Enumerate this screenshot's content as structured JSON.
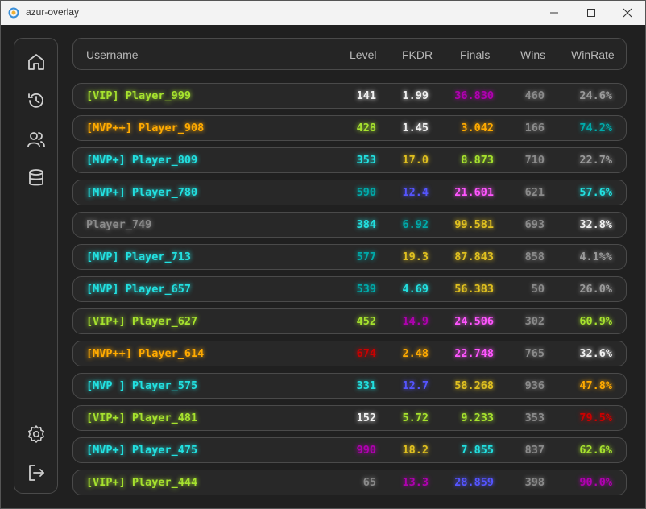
{
  "window": {
    "title": "azur-overlay"
  },
  "sidebar": {
    "items": [
      {
        "name": "home-icon"
      },
      {
        "name": "history-icon"
      },
      {
        "name": "users-icon"
      },
      {
        "name": "database-icon"
      }
    ],
    "bottom": [
      {
        "name": "settings-icon"
      },
      {
        "name": "logout-icon"
      }
    ]
  },
  "table": {
    "headers": {
      "username": "Username",
      "level": "Level",
      "fkdr": "FKDR",
      "finals": "Finals",
      "wins": "Wins",
      "winrate": "WinRate"
    },
    "rows": [
      {
        "rank": "[VIP] ",
        "name": "Player_999",
        "level": "141",
        "fkdr": "1.99",
        "finals": "36.830",
        "wins": "460",
        "winrate": "24.6%",
        "c": {
          "rank": "#a6e22e",
          "name": "#a6e22e",
          "level": "#f0f0f0",
          "fkdr": "#f0f0f0",
          "finals": "#b000b0",
          "wins": "#8a8a8a",
          "winrate": "#9a9a9a"
        }
      },
      {
        "rank": "[MVP++] ",
        "name": "Player_908",
        "level": "428",
        "fkdr": "1.45",
        "finals": "3.042",
        "wins": "166",
        "winrate": "74.2%",
        "c": {
          "rank": "#ffaa00",
          "name": "#ffaa00",
          "level": "#a6e22e",
          "fkdr": "#f0f0f0",
          "finals": "#ffaa00",
          "wins": "#8a8a8a",
          "winrate": "#00aaaa"
        }
      },
      {
        "rank": "[MVP+] ",
        "name": "Player_809",
        "level": "353",
        "fkdr": "17.0",
        "finals": "8.873",
        "wins": "710",
        "winrate": "22.7%",
        "c": {
          "rank": "#22e0e0",
          "name": "#22e0e0",
          "level": "#22e0e0",
          "fkdr": "#e0c020",
          "finals": "#a6e22e",
          "wins": "#8a8a8a",
          "winrate": "#9a9a9a"
        }
      },
      {
        "rank": "[MVP+] ",
        "name": "Player_780",
        "level": "590",
        "fkdr": "12.4",
        "finals": "21.601",
        "wins": "621",
        "winrate": "57.6%",
        "c": {
          "rank": "#22e0e0",
          "name": "#22e0e0",
          "level": "#00aaaa",
          "fkdr": "#5555ff",
          "finals": "#ff55ff",
          "wins": "#8a8a8a",
          "winrate": "#22e0e0"
        }
      },
      {
        "rank": "",
        "name": "Player_749",
        "level": "384",
        "fkdr": "6.92",
        "finals": "99.581",
        "wins": "693",
        "winrate": "32.8%",
        "c": {
          "rank": "#8a8a8a",
          "name": "#8a8a8a",
          "level": "#22e0e0",
          "fkdr": "#00aaaa",
          "finals": "#e0c020",
          "wins": "#8a8a8a",
          "winrate": "#f0f0f0"
        }
      },
      {
        "rank": "[MVP] ",
        "name": "Player_713",
        "level": "577",
        "fkdr": "19.3",
        "finals": "87.843",
        "wins": "858",
        "winrate": "4.1%%",
        "c": {
          "rank": "#22e0e0",
          "name": "#22e0e0",
          "level": "#00aaaa",
          "fkdr": "#e0c020",
          "finals": "#e0c020",
          "wins": "#8a8a8a",
          "winrate": "#9a9a9a"
        }
      },
      {
        "rank": "[MVP] ",
        "name": "Player_657",
        "level": "539",
        "fkdr": "4.69",
        "finals": "56.383",
        "wins": "50",
        "winrate": "26.0%",
        "c": {
          "rank": "#22e0e0",
          "name": "#22e0e0",
          "level": "#00aaaa",
          "fkdr": "#22e0e0",
          "finals": "#e0c020",
          "wins": "#8a8a8a",
          "winrate": "#9a9a9a"
        }
      },
      {
        "rank": "[VIP+] ",
        "name": "Player_627",
        "level": "452",
        "fkdr": "14.9",
        "finals": "24.506",
        "wins": "302",
        "winrate": "60.9%",
        "c": {
          "rank": "#a6e22e",
          "name": "#a6e22e",
          "level": "#a6e22e",
          "fkdr": "#b000b0",
          "finals": "#ff55ff",
          "wins": "#8a8a8a",
          "winrate": "#a6e22e"
        }
      },
      {
        "rank": "[MVP++] ",
        "name": "Player_614",
        "level": "674",
        "fkdr": "2.48",
        "finals": "22.748",
        "wins": "765",
        "winrate": "32.6%",
        "c": {
          "rank": "#ffaa00",
          "name": "#ffaa00",
          "level": "#cc0000",
          "fkdr": "#ffaa00",
          "finals": "#ff55ff",
          "wins": "#8a8a8a",
          "winrate": "#f0f0f0"
        }
      },
      {
        "rank": "[MVP ] ",
        "name": "Player_575",
        "level": "331",
        "fkdr": "12.7",
        "finals": "58.268",
        "wins": "936",
        "winrate": "47.8%",
        "c": {
          "rank": "#22e0e0",
          "name": "#22e0e0",
          "level": "#22e0e0",
          "fkdr": "#5555ff",
          "finals": "#e0c020",
          "wins": "#8a8a8a",
          "winrate": "#ffaa00"
        }
      },
      {
        "rank": "[VIP+] ",
        "name": "Player_481",
        "level": "152",
        "fkdr": "5.72",
        "finals": "9.233",
        "wins": "353",
        "winrate": "79.5%",
        "c": {
          "rank": "#a6e22e",
          "name": "#a6e22e",
          "level": "#f0f0f0",
          "fkdr": "#a6e22e",
          "finals": "#a6e22e",
          "wins": "#8a8a8a",
          "winrate": "#cc0000"
        }
      },
      {
        "rank": "[MVP+] ",
        "name": "Player_475",
        "level": "990",
        "fkdr": "18.2",
        "finals": "7.855",
        "wins": "837",
        "winrate": "62.6%",
        "c": {
          "rank": "#22e0e0",
          "name": "#22e0e0",
          "level": "#b000b0",
          "fkdr": "#e0c020",
          "finals": "#22e0e0",
          "wins": "#8a8a8a",
          "winrate": "#a6e22e"
        }
      },
      {
        "rank": "[VIP+] ",
        "name": "Player_444",
        "level": "65",
        "fkdr": "13.3",
        "finals": "28.859",
        "wins": "398",
        "winrate": "90.0%",
        "c": {
          "rank": "#a6e22e",
          "name": "#a6e22e",
          "level": "#8a8a8a",
          "fkdr": "#b000b0",
          "finals": "#5555ff",
          "wins": "#8a8a8a",
          "winrate": "#b000b0"
        }
      }
    ]
  }
}
